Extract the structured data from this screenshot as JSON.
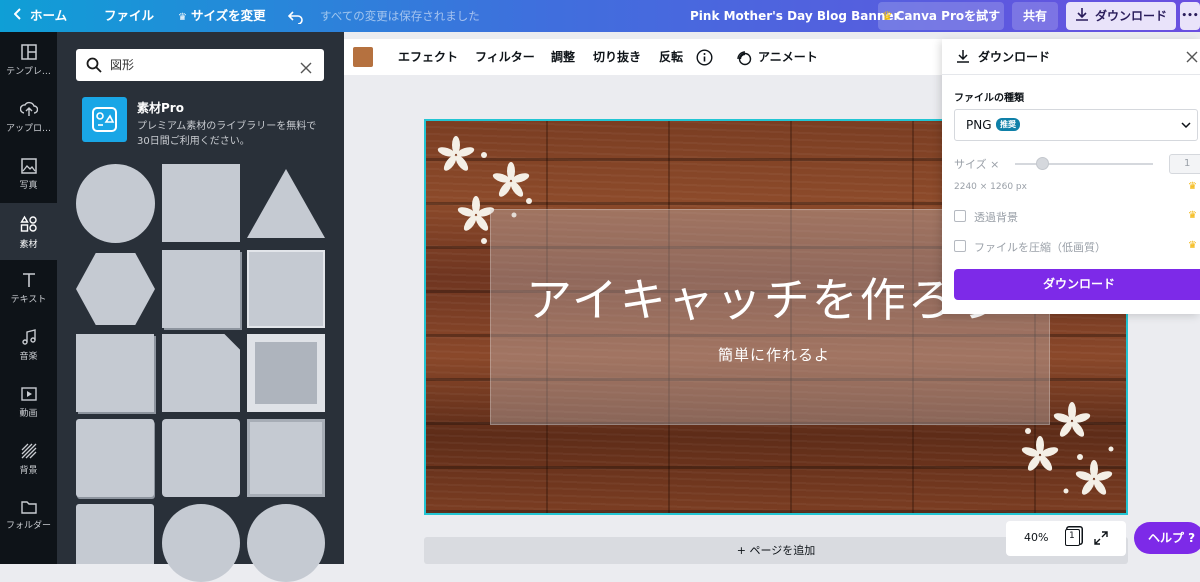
{
  "topbar": {
    "home": "ホーム",
    "file": "ファイル",
    "resize": "サイズを変更",
    "saved": "すべての変更は保存されました",
    "doc_title": "Pink Mother's Day Blog Banner",
    "try_pro": "Canva Proを試す",
    "share": "共有",
    "download": "ダウンロード",
    "more": "•••"
  },
  "rail": {
    "items": [
      {
        "label": "テンプレ…",
        "icon": "template-icon"
      },
      {
        "label": "アップロ…",
        "icon": "upload-icon"
      },
      {
        "label": "写真",
        "icon": "photo-icon"
      },
      {
        "label": "素材",
        "icon": "elements-icon"
      },
      {
        "label": "テキスト",
        "icon": "text-icon"
      },
      {
        "label": "音楽",
        "icon": "music-icon"
      },
      {
        "label": "動画",
        "icon": "video-icon"
      },
      {
        "label": "背景",
        "icon": "background-icon"
      },
      {
        "label": "フォルダー",
        "icon": "folder-icon"
      }
    ]
  },
  "panel": {
    "search_value": "図形",
    "pro_title": "素材Pro",
    "pro_desc_line1": "プレミアム素材のライブラリーを無料で",
    "pro_desc_line2": "30日間ご利用ください。"
  },
  "toolbar": {
    "effects": "エフェクト",
    "filter": "フィルター",
    "adjust": "調整",
    "crop": "切り抜き",
    "flip": "反転",
    "animate": "アニメート",
    "color_swatch": "#b5713f"
  },
  "design": {
    "headline": "アイキャッチを作ろう",
    "subline": "簡単に作れるよ"
  },
  "add_page": "+ ページを追加",
  "download_panel": {
    "title": "ダウンロード",
    "file_type_label": "ファイルの種類",
    "file_type_value": "PNG",
    "recommended_badge": "推奨",
    "size_label": "サイズ ×",
    "size_value": "1",
    "dimensions": "2240 × 1260 px",
    "transparent_bg": "透過背景",
    "compress": "ファイルを圧縮（低画質）",
    "download_button": "ダウンロード"
  },
  "zoom": {
    "level": "40%",
    "page_count": "1"
  },
  "help": "ヘルプ ?",
  "colors": {
    "accent_purple": "#7d2ae8",
    "selection_teal": "#22c5d3",
    "rail_bg": "#0e1318",
    "panel_bg": "#293039"
  }
}
